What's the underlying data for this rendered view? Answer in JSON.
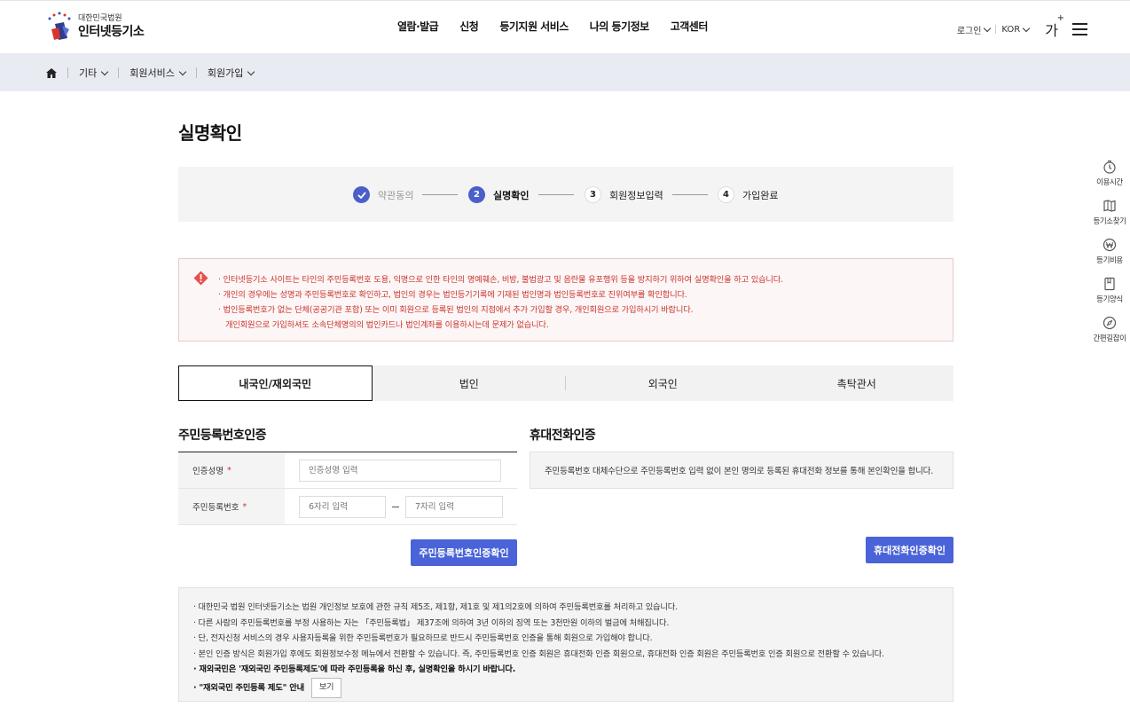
{
  "header": {
    "logo_sub": "대한민국법원",
    "logo_main": "인터넷등기소",
    "nav": [
      "열람·발급",
      "신청",
      "등기지원 서비스",
      "나의 등기정보",
      "고객센터"
    ],
    "login": "로그인",
    "language": "KOR",
    "font_size": "가",
    "font_size_plus": "+"
  },
  "breadcrumb": [
    "기타",
    "회원서비스",
    "회원가입"
  ],
  "page_title": "실명확인",
  "steps": [
    {
      "num": "1",
      "label": "약관동의",
      "state": "done"
    },
    {
      "num": "2",
      "label": "실명확인",
      "state": "current"
    },
    {
      "num": "3",
      "label": "회원정보입력",
      "state": "todo"
    },
    {
      "num": "4",
      "label": "가입완료",
      "state": "todo"
    }
  ],
  "alert": {
    "lines": [
      "· 인터넷등기소 사이트는 타인의 주민등록번호 도용, 익명으로 인한 타인의 명예훼손, 비방, 불법광고 및 음란물 유포행위 등을 방지하기 위하여 실명확인을 하고 있습니다.",
      "· 개인의 경우에는 성명과 주민등록번호로 확인하고, 법인의 경우는 법인등기기록에 기재된 법인명과 법인등록번호로 진위여부를 확인합니다.",
      "· 법인등록번호가 없는 단체(공공기관 포함) 또는 이미 회원으로 등록된 법인의 지점에서 추가 가입할 경우, 개인회원으로 가입하시기 바랍니다.",
      "  개인회원으로 가입하셔도 소속단체명의의 법인카드나 법인계좌를 이용하시는데 문제가 없습니다."
    ],
    "color": "#c8352e"
  },
  "tabs": [
    "내국인/재외국민",
    "법인",
    "외국인",
    "촉탁관서"
  ],
  "resident": {
    "title": "주민등록번호인증",
    "name_label": "인증성명",
    "name_placeholder": "인증성명 입력",
    "rrn_label": "주민등록번호",
    "rrn_front_placeholder": "6자리 입력",
    "rrn_back_placeholder": "7자리 입력",
    "required_mark": "*",
    "button": "주민등록번호인증확인"
  },
  "phone": {
    "title": "휴대전화인증",
    "description": "주민등록번호 대체수단으로 주민등록번호 입력 없이 본인 명의로 등록된 휴대전화 정보를 통해 본인확인을 합니다.",
    "button": "휴대전화인증확인"
  },
  "notes": {
    "lines": [
      "· 대한민국 법원 인터넷등기소는 법원 개인정보 보호에 관한 규칙 제5조, 제1항, 제1호 및 제1의2호에 의하여 주민등록번호를 처리하고 있습니다.",
      "· 다른 사람의 주민등록번호를 부정 사용하는 자는 「주민등록법」 제37조에 의하여 3년 이하의 징역 또는 3천만원 이하의 벌금에 처해집니다.",
      "· 단, 전자신청 서비스의 경우 사용자등록을 위한 주민등록번호가 필요하므로 반드시 주민등록번호 인증을 통해 회원으로 가입해야 합니다.",
      "· 본인 인증 방식은 회원가입 후에도 회원정보수정 메뉴에서 전환할 수 있습니다. 즉, 주민등록번호 인증 회원은 휴대전화 인증 회원으로, 휴대전화 인증 회원은 주민등록번호 인증 회원으로 전환할 수 있습니다."
    ],
    "bold_line": "· 재외국민은 '재외국민 주민등록제도'에 따라 주민등록을 하신 후, 실명확인을 하시기 바랍니다.",
    "guide_line": "· \"재외국민 주민등록 제도\" 안내",
    "view_button": "보기"
  },
  "quick_menu": [
    {
      "label": "이용시간",
      "icon": "clock-icon"
    },
    {
      "label": "등기소찾기",
      "icon": "map-icon"
    },
    {
      "label": "등기비용",
      "icon": "won-icon"
    },
    {
      "label": "등기양식",
      "icon": "document-icon"
    },
    {
      "label": "간편길잡이",
      "icon": "compass-icon"
    }
  ],
  "accent_color": "#4a63d8"
}
